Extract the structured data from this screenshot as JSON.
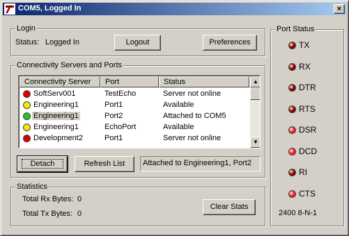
{
  "window": {
    "title": "COM5, Logged In",
    "close_glyph": "×",
    "icon": "app-logo-icon"
  },
  "login": {
    "group_label": "Login",
    "status_label": "Status:",
    "status_value": "Logged In",
    "logout_label": "Logout",
    "preferences_label": "Preferences"
  },
  "connectivity": {
    "group_label": "Connectivity Servers and Ports",
    "columns": [
      "Connectivity Server",
      "Port",
      "Status"
    ],
    "rows": [
      {
        "server": "SoftServ001",
        "port": "TestEcho",
        "status": "Server not online",
        "color": "#e00000"
      },
      {
        "server": "Engineering1",
        "port": "Port1",
        "status": "Available",
        "color": "#f5e800"
      },
      {
        "server": "Engineering1",
        "port": "Port2",
        "status": "Attached to COM5",
        "color": "#20c820"
      },
      {
        "server": "Engineering1",
        "port": "EchoPort",
        "status": "Available",
        "color": "#f5e800"
      },
      {
        "server": "Development2",
        "port": "Port1",
        "status": "Server not online",
        "color": "#e00000"
      }
    ],
    "detach_label": "Detach",
    "refresh_label": "Refresh List",
    "attach_status": "Attached to Engineering1, Port2"
  },
  "statistics": {
    "group_label": "Statistics",
    "rx_label": "Total Rx Bytes:",
    "rx_value": "0",
    "tx_label": "Total Tx Bytes:",
    "tx_value": "0",
    "clear_label": "Clear Stats"
  },
  "port_status": {
    "group_label": "Port Status",
    "signals": [
      {
        "name": "TX",
        "color": "#8a0000"
      },
      {
        "name": "RX",
        "color": "#8a0000"
      },
      {
        "name": "DTR",
        "color": "#8a0000"
      },
      {
        "name": "RTS",
        "color": "#8a0000"
      },
      {
        "name": "DSR",
        "color": "#ff2020"
      },
      {
        "name": "DCD",
        "color": "#ff2020"
      },
      {
        "name": "RI",
        "color": "#8a0000"
      },
      {
        "name": "CTS",
        "color": "#ff2020"
      }
    ],
    "settings": "2400 8-N-1"
  }
}
